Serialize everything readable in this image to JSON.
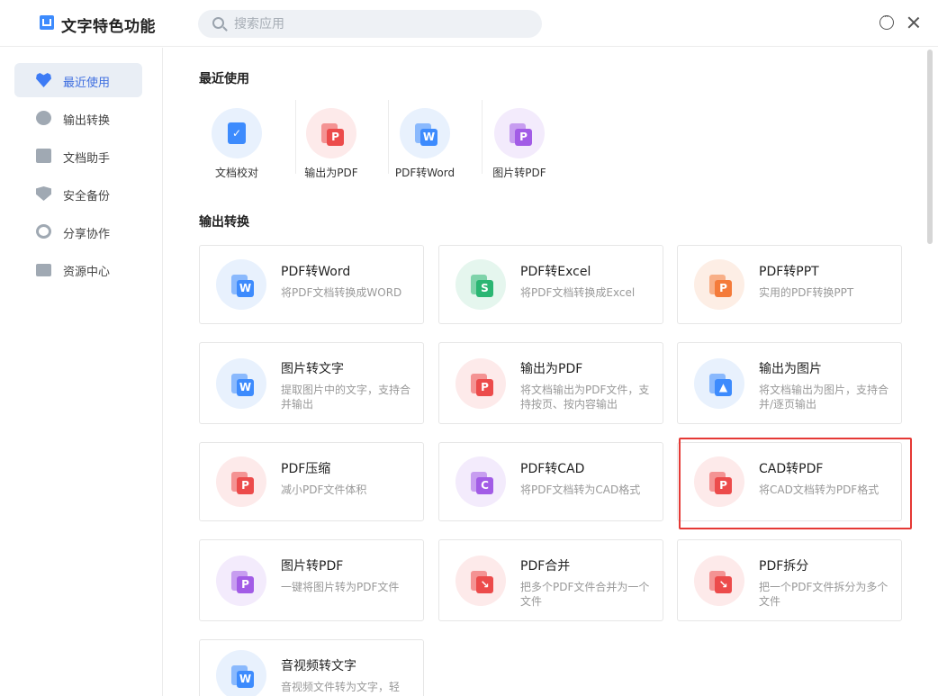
{
  "app": {
    "title": "文字特色功能"
  },
  "search": {
    "placeholder": "搜索应用"
  },
  "sidebar": {
    "items": [
      {
        "label": "最近使用"
      },
      {
        "label": "输出转换"
      },
      {
        "label": "文档助手"
      },
      {
        "label": "安全备份"
      },
      {
        "label": "分享协作"
      },
      {
        "label": "资源中心"
      }
    ]
  },
  "recent": {
    "title": "最近使用",
    "items": [
      {
        "label": "文档校对",
        "icon": "proofread-icon",
        "color": "#3d8bfd"
      },
      {
        "label": "输出为PDF",
        "icon": "export-pdf-icon",
        "color": "#ec4b4b"
      },
      {
        "label": "PDF转Word",
        "icon": "pdf-to-word-icon",
        "color": "#3d8bfd"
      },
      {
        "label": "图片转PDF",
        "icon": "image-to-pdf-icon",
        "color": "#a25ce6"
      }
    ]
  },
  "convert": {
    "title": "输出转换",
    "cards": [
      {
        "title": "PDF转Word",
        "desc": "将PDF文档转换成WORD",
        "badge": "W",
        "color": "#3d8bfd",
        "bg": "#e8f1fd"
      },
      {
        "title": "PDF转Excel",
        "desc": "将PDF文档转换成Excel",
        "badge": "S",
        "color": "#2bb673",
        "bg": "#e5f6ee"
      },
      {
        "title": "PDF转PPT",
        "desc": "实用的PDF转换PPT",
        "badge": "P",
        "color": "#f47b3a",
        "bg": "#fdeee5"
      },
      {
        "title": "图片转文字",
        "desc": "提取图片中的文字，支持合并输出",
        "badge": "W",
        "color": "#3d8bfd",
        "bg": "#e8f1fd"
      },
      {
        "title": "输出为PDF",
        "desc": "将文档输出为PDF文件，支持按页、按内容输出",
        "badge": "P",
        "color": "#ec4b4b",
        "bg": "#fdeaea"
      },
      {
        "title": "输出为图片",
        "desc": "将文档输出为图片，支持合并/逐页输出",
        "badge": "▲",
        "color": "#3d8bfd",
        "bg": "#e8f1fd"
      },
      {
        "title": "PDF压缩",
        "desc": "减小PDF文件体积",
        "badge": "P",
        "color": "#ec4b4b",
        "bg": "#fdeaea"
      },
      {
        "title": "PDF转CAD",
        "desc": "将PDF文档转为CAD格式",
        "badge": "C",
        "color": "#a25ce6",
        "bg": "#f3ebfc"
      },
      {
        "title": "CAD转PDF",
        "desc": "将CAD文档转为PDF格式",
        "badge": "P",
        "color": "#ec4b4b",
        "bg": "#fdeaea"
      },
      {
        "title": "图片转PDF",
        "desc": "一键将图片转为PDF文件",
        "badge": "P",
        "color": "#a25ce6",
        "bg": "#f3ebfc"
      },
      {
        "title": "PDF合并",
        "desc": "把多个PDF文件合并为一个文件",
        "badge": "↘",
        "color": "#ec4b4b",
        "bg": "#fdeaea"
      },
      {
        "title": "PDF拆分",
        "desc": "把一个PDF文件拆分为多个文件",
        "badge": "↘",
        "color": "#ec4b4b",
        "bg": "#fdeaea"
      },
      {
        "title": "音视频转文字",
        "desc": "音视频文件转为文字，轻",
        "badge": "W",
        "color": "#3d8bfd",
        "bg": "#e8f1fd"
      }
    ]
  }
}
